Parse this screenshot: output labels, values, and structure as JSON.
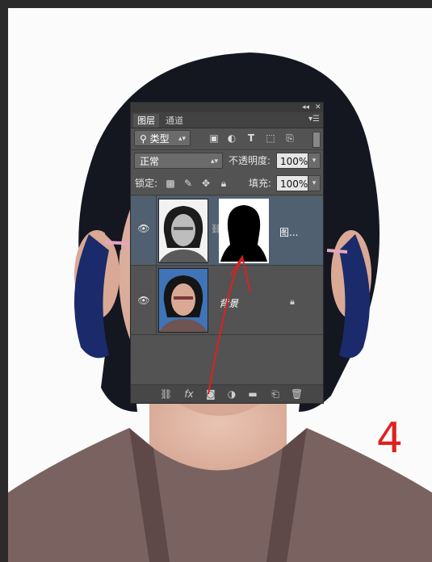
{
  "panel": {
    "tabs": [
      {
        "label": "图层",
        "active": true
      },
      {
        "label": "通道",
        "active": false
      }
    ],
    "filter": {
      "label": "类型"
    },
    "blend": {
      "mode": "正常",
      "opacity_label": "不透明度:",
      "opacity_value": "100%"
    },
    "lock": {
      "label": "锁定:",
      "fill_label": "填充:",
      "fill_value": "100%"
    },
    "layers": [
      {
        "name": "图...",
        "selected": true,
        "has_mask": true
      },
      {
        "name": "背景",
        "selected": false,
        "locked": true
      }
    ],
    "footer_icons": [
      "link-icon",
      "fx-icon",
      "add-mask-icon",
      "adjustment-icon",
      "folder-icon",
      "new-layer-icon",
      "trash-icon"
    ]
  },
  "annotation": {
    "number": "4",
    "color": "#e0201e"
  },
  "colors": {
    "panel_bg": "#535353",
    "selected_layer": "#516070"
  }
}
